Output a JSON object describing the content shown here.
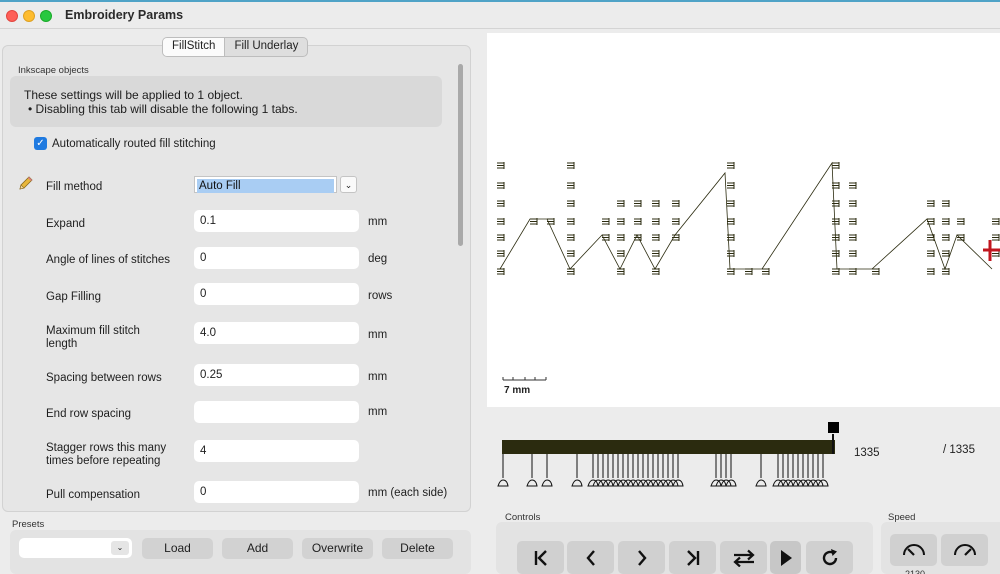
{
  "window": {
    "title": "Embroidery Params"
  },
  "tabs": [
    {
      "label": "FillStitch"
    },
    {
      "label": "Fill Underlay"
    }
  ],
  "objects_group": {
    "label": "Inkscape objects",
    "info_line1": "These settings will be applied to 1 object.",
    "info_line2": "• Disabling this tab will disable the following 1 tabs."
  },
  "auto_route": {
    "label": "Automatically routed fill stitching",
    "checked": true
  },
  "fill_method": {
    "label": "Fill method",
    "value": "Auto Fill"
  },
  "params": [
    {
      "label": "Expand",
      "value": "0.1",
      "unit": "mm"
    },
    {
      "label": "Angle of lines of stitches",
      "value": "0",
      "unit": "deg"
    },
    {
      "label": "Gap Filling",
      "value": "0",
      "unit": "rows"
    },
    {
      "label": "Maximum fill stitch length",
      "value": "4.0",
      "unit": "mm"
    },
    {
      "label": "Spacing between rows",
      "value": "0.25",
      "unit": "mm"
    },
    {
      "label": "End row spacing",
      "value": "",
      "unit": "mm"
    },
    {
      "label": "Stagger rows this many times before repeating",
      "value": "4",
      "unit": ""
    },
    {
      "label": "Pull compensation",
      "value": "0",
      "unit": "mm (each side)"
    }
  ],
  "presets": {
    "label": "Presets",
    "selected": "",
    "buttons": {
      "load": "Load",
      "add": "Add",
      "overwrite": "Overwrite",
      "delete": "Delete"
    }
  },
  "preview": {
    "scale_label": "7 mm",
    "stitch_color": "#2b2b0f"
  },
  "timeline": {
    "current": "1335",
    "total": "/ 1335"
  },
  "controls": {
    "label": "Controls",
    "buttons": [
      "jump-to-start",
      "step-backward",
      "step-forward",
      "jump-to-end",
      "direction",
      "play",
      "restart"
    ]
  },
  "speed": {
    "label": "Speed",
    "value": "2130 stitches/sec"
  }
}
